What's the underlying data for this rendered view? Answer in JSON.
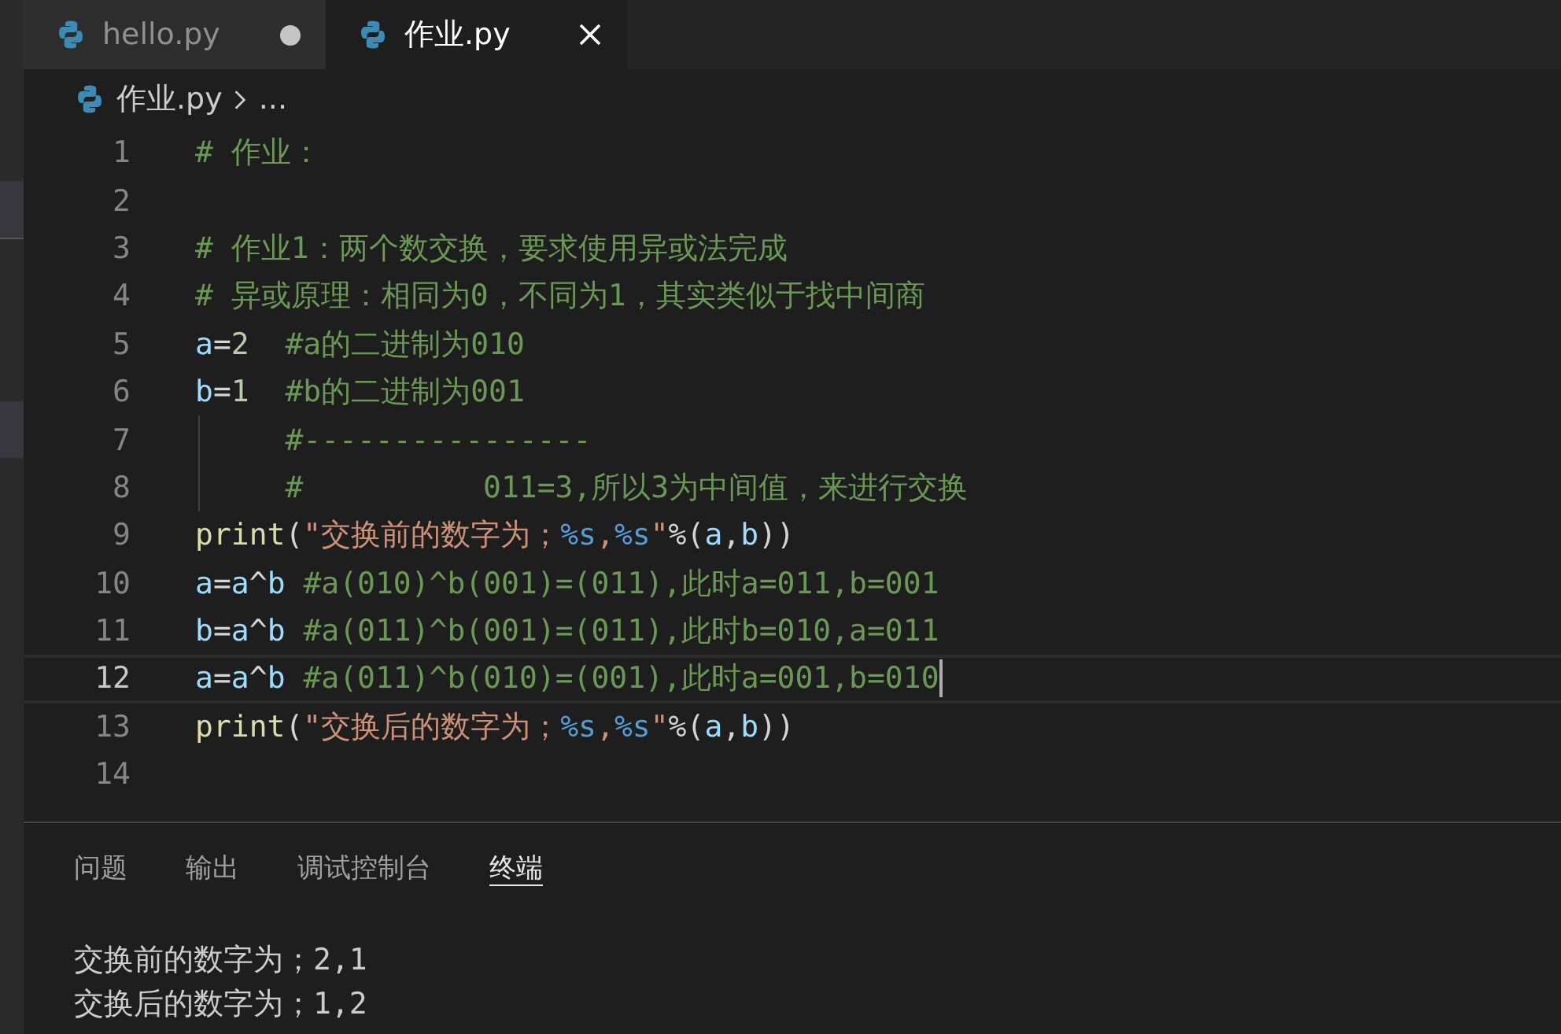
{
  "tabs": [
    {
      "label": "hello.py",
      "selected": false,
      "modified": true
    },
    {
      "label": "作业.py",
      "selected": true,
      "modified": false
    }
  ],
  "breadcrumb": {
    "file": "作业.py",
    "rest": "..."
  },
  "lines": [
    {
      "number": "1",
      "current": false,
      "guide": false,
      "tokens": [
        {
          "kind": "comment",
          "text": "# 作业："
        }
      ]
    },
    {
      "number": "2",
      "current": false,
      "guide": false
    },
    {
      "number": "3",
      "current": false,
      "guide": false,
      "tokens": [
        {
          "kind": "comment",
          "text": "# 作业1：两个数交换，要求使用异或法完成"
        }
      ]
    },
    {
      "number": "4",
      "current": false,
      "guide": false,
      "tokens": [
        {
          "kind": "comment",
          "text": "# 异或原理：相同为0，不同为1，其实类似于找中间商"
        }
      ]
    },
    {
      "number": "5",
      "current": false,
      "guide": false,
      "tokens": [
        {
          "kind": "var",
          "text": "a"
        },
        {
          "kind": "plain",
          "text": "="
        },
        {
          "kind": "num",
          "text": "2"
        },
        {
          "kind": "comment",
          "text": "  #a的二进制为010"
        }
      ]
    },
    {
      "number": "6",
      "current": false,
      "guide": false,
      "tokens": [
        {
          "kind": "var",
          "text": "b"
        },
        {
          "kind": "plain",
          "text": "="
        },
        {
          "kind": "num",
          "text": "1"
        },
        {
          "kind": "comment",
          "text": "  #b的二进制为001"
        }
      ]
    },
    {
      "number": "7",
      "current": false,
      "guide": true,
      "tokens": [
        {
          "kind": "comment",
          "text": "     #----------------"
        }
      ]
    },
    {
      "number": "8",
      "current": false,
      "guide": true,
      "tokens": [
        {
          "kind": "comment",
          "text": "     #          011=3,所以3为中间值，来进行交换"
        }
      ]
    },
    {
      "number": "9",
      "current": false,
      "guide": false,
      "tokens": [
        {
          "kind": "func",
          "text": "print"
        },
        {
          "kind": "plain",
          "text": "("
        },
        {
          "kind": "str",
          "text": "\"交换前的数字为；"
        },
        {
          "kind": "fmt",
          "text": "%s"
        },
        {
          "kind": "str",
          "text": ","
        },
        {
          "kind": "fmt",
          "text": "%s"
        },
        {
          "kind": "str",
          "text": "\""
        },
        {
          "kind": "plain",
          "text": "%("
        },
        {
          "kind": "var",
          "text": "a"
        },
        {
          "kind": "plain",
          "text": ","
        },
        {
          "kind": "var",
          "text": "b"
        },
        {
          "kind": "plain",
          "text": "))"
        }
      ]
    },
    {
      "number": "10",
      "current": false,
      "guide": false,
      "tokens": [
        {
          "kind": "var",
          "text": "a"
        },
        {
          "kind": "plain",
          "text": "="
        },
        {
          "kind": "var",
          "text": "a"
        },
        {
          "kind": "plain",
          "text": "^"
        },
        {
          "kind": "var",
          "text": "b"
        },
        {
          "kind": "comment",
          "text": " #a(010)^b(001)=(011),此时a=011,b=001"
        }
      ]
    },
    {
      "number": "11",
      "current": false,
      "guide": false,
      "tokens": [
        {
          "kind": "var",
          "text": "b"
        },
        {
          "kind": "plain",
          "text": "="
        },
        {
          "kind": "var",
          "text": "a"
        },
        {
          "kind": "plain",
          "text": "^"
        },
        {
          "kind": "var",
          "text": "b"
        },
        {
          "kind": "comment",
          "text": " #a(011)^b(001)=(011),此时b=010,a=011"
        }
      ]
    },
    {
      "number": "12",
      "current": true,
      "guide": false,
      "tokens": [
        {
          "kind": "var",
          "text": "a"
        },
        {
          "kind": "plain",
          "text": "="
        },
        {
          "kind": "var",
          "text": "a"
        },
        {
          "kind": "plain",
          "text": "^"
        },
        {
          "kind": "var",
          "text": "b"
        },
        {
          "kind": "comment",
          "text": " #a(011)^b(010)=(001),此时a=001,b=010"
        }
      ]
    },
    {
      "number": "13",
      "current": false,
      "guide": false,
      "tokens": [
        {
          "kind": "func",
          "text": "print"
        },
        {
          "kind": "plain",
          "text": "("
        },
        {
          "kind": "str",
          "text": "\"交换后的数字为；"
        },
        {
          "kind": "fmt",
          "text": "%s"
        },
        {
          "kind": "str",
          "text": ","
        },
        {
          "kind": "fmt",
          "text": "%s"
        },
        {
          "kind": "str",
          "text": "\""
        },
        {
          "kind": "plain",
          "text": "%("
        },
        {
          "kind": "var",
          "text": "a"
        },
        {
          "kind": "plain",
          "text": ","
        },
        {
          "kind": "var",
          "text": "b"
        },
        {
          "kind": "plain",
          "text": "))"
        }
      ]
    },
    {
      "number": "14",
      "current": false,
      "guide": false
    }
  ],
  "panel": {
    "tabs": [
      {
        "label": "问题",
        "selected": false
      },
      {
        "label": "输出",
        "selected": false
      },
      {
        "label": "调试控制台",
        "selected": false
      },
      {
        "label": "终端",
        "selected": true
      }
    ],
    "terminal_lines": [
      "交换前的数字为；2,1",
      "交换后的数字为；1,2"
    ]
  }
}
